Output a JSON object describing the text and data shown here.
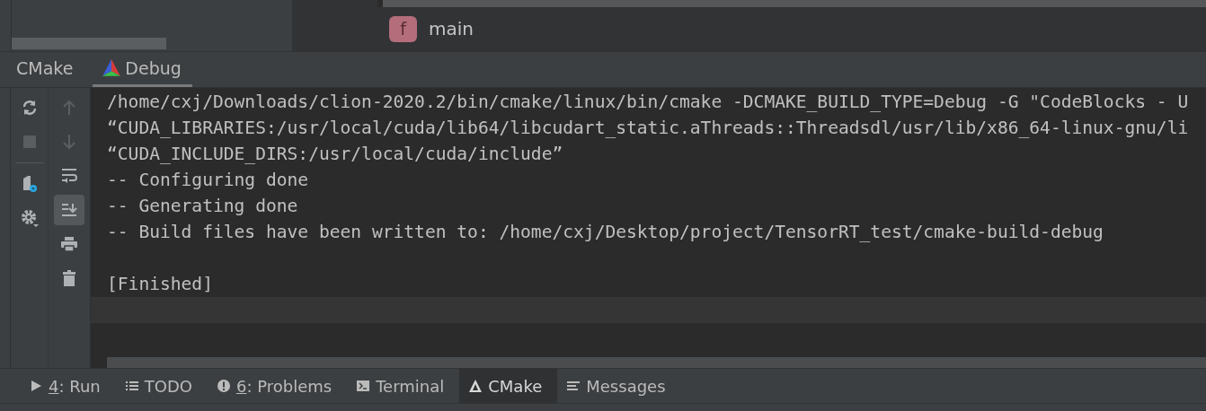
{
  "editor": {
    "breadcrumb": {
      "icon_letter": "f",
      "label": "main"
    }
  },
  "tool_window": {
    "tabs": [
      {
        "label": "CMake",
        "kind": "plain",
        "selected": false
      },
      {
        "label": "Debug",
        "kind": "config",
        "selected": true
      }
    ],
    "toolbar_left": [
      {
        "kind": "refresh",
        "disabled": false
      },
      {
        "kind": "stop",
        "disabled": true
      },
      {
        "kind": "settings-file",
        "disabled": false
      },
      {
        "kind": "gear",
        "disabled": false
      }
    ],
    "toolbar_right": [
      {
        "kind": "up",
        "disabled": true,
        "selected": false
      },
      {
        "kind": "down",
        "disabled": true,
        "selected": false
      },
      {
        "kind": "wrap",
        "disabled": false,
        "selected": false
      },
      {
        "kind": "scroll-end",
        "disabled": false,
        "selected": true
      },
      {
        "kind": "print",
        "disabled": false,
        "selected": false
      },
      {
        "kind": "trash",
        "disabled": false,
        "selected": false
      }
    ],
    "console": [
      {
        "text": "/home/cxj/Downloads/clion-2020.2/bin/cmake/linux/bin/cmake -DCMAKE_BUILD_TYPE=Debug -G \"CodeBlocks - U",
        "kind": "output"
      },
      {
        "text": "“CUDA_LIBRARIES:/usr/local/cuda/lib64/libcudart_static.aThreads::Threadsdl/usr/lib/x86_64-linux-gnu/li",
        "kind": "output"
      },
      {
        "text": "“CUDA_INCLUDE_DIRS:/usr/local/cuda/include”",
        "kind": "output"
      },
      {
        "text": "-- Configuring done",
        "kind": "output"
      },
      {
        "text": "-- Generating done",
        "kind": "output"
      },
      {
        "text": "-- Build files have been written to: /home/cxj/Desktop/project/TensorRT_test/cmake-build-debug",
        "kind": "output"
      },
      {
        "kind": "blank"
      },
      {
        "text": "[Finished]",
        "kind": "output"
      }
    ],
    "caret_line_highlight": true
  },
  "bottom_tabs": [
    {
      "kind": "run",
      "key": "4",
      "label": ": Run",
      "selected": false
    },
    {
      "kind": "todo",
      "label": "TODO",
      "selected": false
    },
    {
      "kind": "problems",
      "key": "6",
      "label": ": Problems",
      "selected": false
    },
    {
      "kind": "terminal",
      "label": "Terminal",
      "selected": false
    },
    {
      "kind": "cmake",
      "label": "CMake",
      "selected": true
    },
    {
      "kind": "messages",
      "label": "Messages",
      "selected": false
    }
  ]
}
